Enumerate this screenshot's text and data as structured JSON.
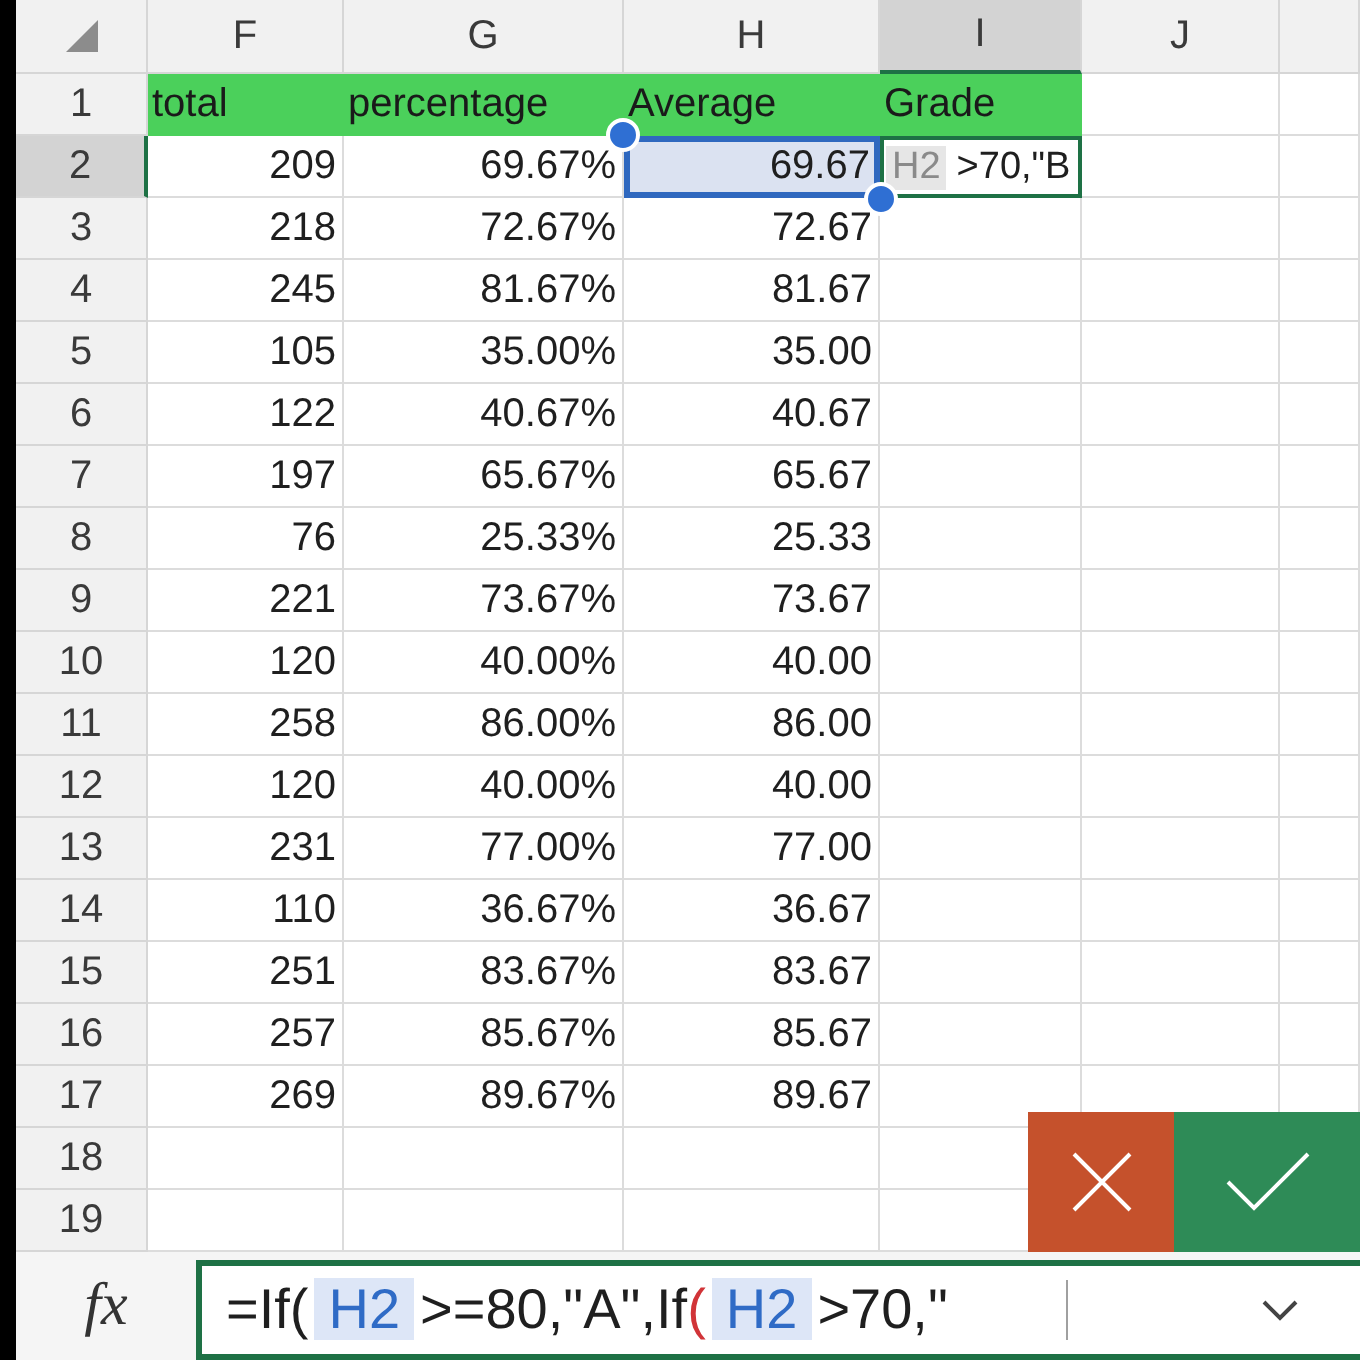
{
  "columns": [
    {
      "label": "F",
      "selected": false
    },
    {
      "label": "G",
      "selected": false
    },
    {
      "label": "H",
      "selected": false
    },
    {
      "label": "I",
      "selected": true
    },
    {
      "label": "J",
      "selected": false
    }
  ],
  "rows": [
    {
      "number": "1",
      "selected": false,
      "kind": "header",
      "cells": [
        {
          "text": "total",
          "selected": false
        },
        {
          "text": "percentage",
          "selected": false
        },
        {
          "text": "Average",
          "selected": false
        },
        {
          "text": "Grade",
          "selected": false
        }
      ]
    },
    {
      "number": "2",
      "selected": true,
      "kind": "data",
      "cells": [
        {
          "text": "209",
          "selected": false
        },
        {
          "text": "69.67%",
          "selected": false
        },
        {
          "text": "69.67",
          "selected": true
        }
      ],
      "edit_cell": {
        "parts": [
          {
            "kind": "ref",
            "text": "H2"
          },
          {
            "kind": "text",
            "text": ">70,\"B"
          }
        ]
      }
    },
    {
      "number": "3",
      "selected": false,
      "kind": "data",
      "cells": [
        {
          "text": "218",
          "selected": false
        },
        {
          "text": "72.67%",
          "selected": false
        },
        {
          "text": "72.67",
          "selected": false
        }
      ]
    },
    {
      "number": "4",
      "selected": false,
      "kind": "data",
      "cells": [
        {
          "text": "245",
          "selected": false
        },
        {
          "text": "81.67%",
          "selected": false
        },
        {
          "text": "81.67",
          "selected": false
        }
      ]
    },
    {
      "number": "5",
      "selected": false,
      "kind": "data",
      "cells": [
        {
          "text": "105",
          "selected": false
        },
        {
          "text": "35.00%",
          "selected": false
        },
        {
          "text": "35.00",
          "selected": false
        }
      ]
    },
    {
      "number": "6",
      "selected": false,
      "kind": "data",
      "cells": [
        {
          "text": "122",
          "selected": false
        },
        {
          "text": "40.67%",
          "selected": false
        },
        {
          "text": "40.67",
          "selected": false
        }
      ]
    },
    {
      "number": "7",
      "selected": false,
      "kind": "data",
      "cells": [
        {
          "text": "197",
          "selected": false
        },
        {
          "text": "65.67%",
          "selected": false
        },
        {
          "text": "65.67",
          "selected": false
        }
      ]
    },
    {
      "number": "8",
      "selected": false,
      "kind": "data",
      "cells": [
        {
          "text": "76",
          "selected": false
        },
        {
          "text": "25.33%",
          "selected": false
        },
        {
          "text": "25.33",
          "selected": false
        }
      ]
    },
    {
      "number": "9",
      "selected": false,
      "kind": "data",
      "cells": [
        {
          "text": "221",
          "selected": false
        },
        {
          "text": "73.67%",
          "selected": false
        },
        {
          "text": "73.67",
          "selected": false
        }
      ]
    },
    {
      "number": "10",
      "selected": false,
      "kind": "data",
      "cells": [
        {
          "text": "120",
          "selected": false
        },
        {
          "text": "40.00%",
          "selected": false
        },
        {
          "text": "40.00",
          "selected": false
        }
      ]
    },
    {
      "number": "11",
      "selected": false,
      "kind": "data",
      "cells": [
        {
          "text": "258",
          "selected": false
        },
        {
          "text": "86.00%",
          "selected": false
        },
        {
          "text": "86.00",
          "selected": false
        }
      ]
    },
    {
      "number": "12",
      "selected": false,
      "kind": "data",
      "cells": [
        {
          "text": "120",
          "selected": false
        },
        {
          "text": "40.00%",
          "selected": false
        },
        {
          "text": "40.00",
          "selected": false
        }
      ]
    },
    {
      "number": "13",
      "selected": false,
      "kind": "data",
      "cells": [
        {
          "text": "231",
          "selected": false
        },
        {
          "text": "77.00%",
          "selected": false
        },
        {
          "text": "77.00",
          "selected": false
        }
      ]
    },
    {
      "number": "14",
      "selected": false,
      "kind": "data",
      "cells": [
        {
          "text": "110",
          "selected": false
        },
        {
          "text": "36.67%",
          "selected": false
        },
        {
          "text": "36.67",
          "selected": false
        }
      ]
    },
    {
      "number": "15",
      "selected": false,
      "kind": "data",
      "cells": [
        {
          "text": "251",
          "selected": false
        },
        {
          "text": "83.67%",
          "selected": false
        },
        {
          "text": "83.67",
          "selected": false
        }
      ]
    },
    {
      "number": "16",
      "selected": false,
      "kind": "data",
      "cells": [
        {
          "text": "257",
          "selected": false
        },
        {
          "text": "85.67%",
          "selected": false
        },
        {
          "text": "85.67",
          "selected": false
        }
      ]
    },
    {
      "number": "17",
      "selected": false,
      "kind": "data",
      "cells": [
        {
          "text": "269",
          "selected": false
        },
        {
          "text": "89.67%",
          "selected": false
        },
        {
          "text": "89.67",
          "selected": false
        }
      ]
    },
    {
      "number": "18",
      "selected": false,
      "kind": "data"
    },
    {
      "number": "19",
      "selected": false,
      "kind": "data"
    }
  ],
  "formula_bar": {
    "label": "fx",
    "parts": [
      {
        "kind": "text",
        "text": "=If("
      },
      {
        "kind": "ref",
        "text": "H2"
      },
      {
        "kind": "text",
        "text": ">=80,\"A\",If"
      },
      {
        "kind": "paren",
        "text": "("
      },
      {
        "kind": "ref",
        "text": "H2"
      },
      {
        "kind": "text",
        "text": ">70,\""
      }
    ]
  },
  "actions": [
    {
      "kind": "cancel"
    },
    {
      "kind": "confirm"
    }
  ]
}
